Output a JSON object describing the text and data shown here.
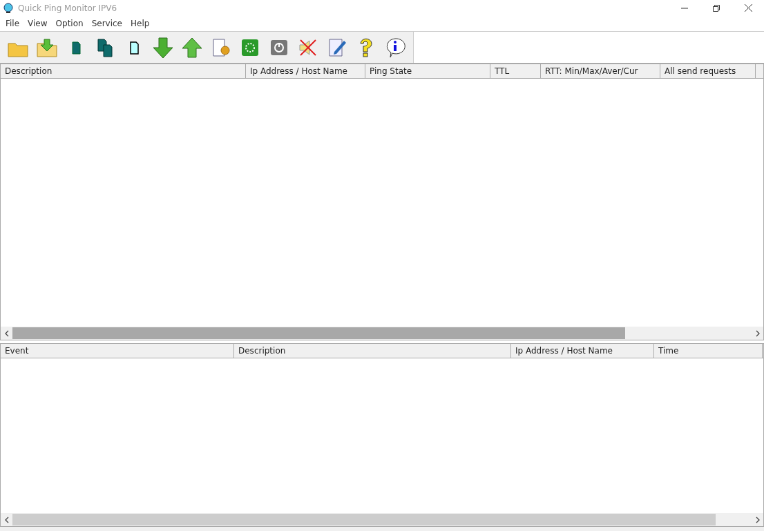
{
  "window": {
    "title": "Quick Ping Monitor IPV6"
  },
  "menu": [
    "File",
    "View",
    "Option",
    "Service",
    "Help"
  ],
  "hosts_table": {
    "columns": [
      "Description",
      "Ip Address / Host Name",
      "Ping State",
      "TTL",
      "RTT: Min/Max/Aver/Cur",
      "All send requests"
    ]
  },
  "events_table": {
    "columns": [
      "Event",
      "Description",
      "Ip Address / Host Name",
      "Time"
    ]
  }
}
